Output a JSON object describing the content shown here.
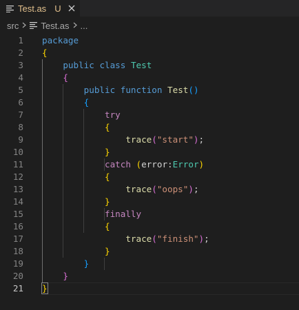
{
  "tab": {
    "label": "Test.as",
    "status": "U",
    "close_icon": "close-icon"
  },
  "breadcrumb": {
    "folder": "src",
    "file": "Test.as",
    "more": "..."
  },
  "colors": {
    "keyword": "#569cd6",
    "control": "#c586c0",
    "type": "#4ec9b0",
    "function": "#dcdcaa",
    "string": "#ce9178",
    "bracket1": "#ffd700",
    "bracket2": "#da70d6",
    "bracket3": "#179fff"
  },
  "code": {
    "current_line": 21,
    "lines": [
      {
        "n": "1",
        "tokens": [
          {
            "t": "package",
            "c": "kw"
          }
        ]
      },
      {
        "n": "2",
        "tokens": [
          {
            "t": "{",
            "c": "b1"
          }
        ]
      },
      {
        "n": "3",
        "tokens": [
          {
            "t": "    "
          },
          {
            "t": "public",
            "c": "kw"
          },
          {
            "t": " "
          },
          {
            "t": "class",
            "c": "kw"
          },
          {
            "t": " "
          },
          {
            "t": "Test",
            "c": "typ"
          }
        ]
      },
      {
        "n": "4",
        "tokens": [
          {
            "t": "    "
          },
          {
            "t": "{",
            "c": "b2"
          }
        ]
      },
      {
        "n": "5",
        "tokens": [
          {
            "t": "        "
          },
          {
            "t": "public",
            "c": "kw"
          },
          {
            "t": " "
          },
          {
            "t": "function",
            "c": "kw"
          },
          {
            "t": " "
          },
          {
            "t": "Test",
            "c": "fn"
          },
          {
            "t": "()",
            "c": "b3"
          }
        ]
      },
      {
        "n": "6",
        "tokens": [
          {
            "t": "        "
          },
          {
            "t": "{",
            "c": "b3"
          }
        ]
      },
      {
        "n": "7",
        "tokens": [
          {
            "t": "            "
          },
          {
            "t": "try",
            "c": "ctl"
          }
        ]
      },
      {
        "n": "8",
        "tokens": [
          {
            "t": "            "
          },
          {
            "t": "{",
            "c": "b1"
          }
        ]
      },
      {
        "n": "9",
        "tokens": [
          {
            "t": "                "
          },
          {
            "t": "trace",
            "c": "fn"
          },
          {
            "t": "(",
            "c": "b2"
          },
          {
            "t": "\"start\"",
            "c": "str"
          },
          {
            "t": ")",
            "c": "b2"
          },
          {
            "t": ";",
            "c": "plain"
          }
        ]
      },
      {
        "n": "10",
        "tokens": [
          {
            "t": "            "
          },
          {
            "t": "}",
            "c": "b1"
          }
        ]
      },
      {
        "n": "11",
        "tokens": [
          {
            "t": "            "
          },
          {
            "t": "catch",
            "c": "ctl"
          },
          {
            "t": " "
          },
          {
            "t": "(",
            "c": "b1"
          },
          {
            "t": "error",
            "c": "plain"
          },
          {
            "t": ":",
            "c": "plain"
          },
          {
            "t": "Error",
            "c": "typ"
          },
          {
            "t": ")",
            "c": "b1"
          }
        ]
      },
      {
        "n": "12",
        "tokens": [
          {
            "t": "            "
          },
          {
            "t": "{",
            "c": "b1"
          }
        ]
      },
      {
        "n": "13",
        "tokens": [
          {
            "t": "                "
          },
          {
            "t": "trace",
            "c": "fn"
          },
          {
            "t": "(",
            "c": "b2"
          },
          {
            "t": "\"oops\"",
            "c": "str"
          },
          {
            "t": ")",
            "c": "b2"
          },
          {
            "t": ";",
            "c": "plain"
          }
        ]
      },
      {
        "n": "14",
        "tokens": [
          {
            "t": "            "
          },
          {
            "t": "}",
            "c": "b1"
          }
        ]
      },
      {
        "n": "15",
        "tokens": [
          {
            "t": "            "
          },
          {
            "t": "finally",
            "c": "ctl"
          }
        ]
      },
      {
        "n": "16",
        "tokens": [
          {
            "t": "            "
          },
          {
            "t": "{",
            "c": "b1"
          }
        ]
      },
      {
        "n": "17",
        "tokens": [
          {
            "t": "                "
          },
          {
            "t": "trace",
            "c": "fn"
          },
          {
            "t": "(",
            "c": "b2"
          },
          {
            "t": "\"finish\"",
            "c": "str"
          },
          {
            "t": ")",
            "c": "b2"
          },
          {
            "t": ";",
            "c": "plain"
          }
        ]
      },
      {
        "n": "18",
        "tokens": [
          {
            "t": "            "
          },
          {
            "t": "}",
            "c": "b1"
          }
        ]
      },
      {
        "n": "19",
        "tokens": [
          {
            "t": "        "
          },
          {
            "t": "}",
            "c": "b3"
          }
        ]
      },
      {
        "n": "20",
        "tokens": [
          {
            "t": "    "
          },
          {
            "t": "}",
            "c": "b2"
          }
        ]
      },
      {
        "n": "21",
        "tokens": [
          {
            "t": "}",
            "c": "b1"
          }
        ]
      }
    ]
  }
}
